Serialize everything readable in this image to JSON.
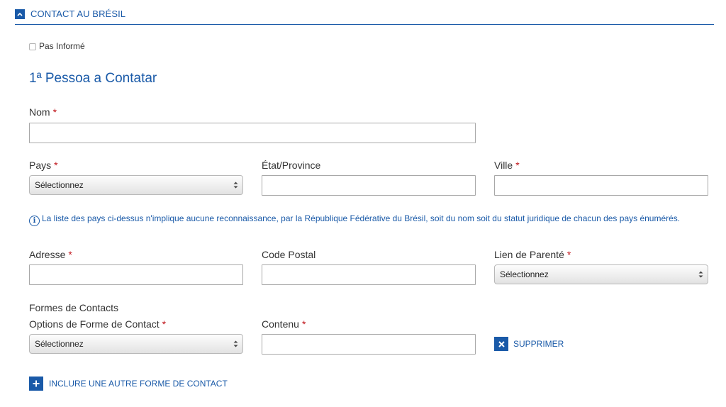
{
  "section": {
    "title": "CONTACT AU BRÉSIL"
  },
  "not_informed": {
    "label": "Pas Informé"
  },
  "person": {
    "title": "1ª Pessoa a Contatar"
  },
  "fields": {
    "name": {
      "label": "Nom",
      "value": ""
    },
    "country": {
      "label": "Pays",
      "selected": "Sélectionnez"
    },
    "state": {
      "label": "État/Province",
      "value": ""
    },
    "city": {
      "label": "Ville",
      "value": ""
    },
    "address": {
      "label": "Adresse",
      "value": ""
    },
    "postal": {
      "label": "Code Postal",
      "value": ""
    },
    "kinship": {
      "label": "Lien de Parenté",
      "selected": "Sélectionnez"
    }
  },
  "required_marker": "*",
  "info": {
    "text": "La liste des pays ci-dessus n'implique aucune reconnaissance, par la République Fédérative du Brésil, soit du nom soit du statut juridique de chacun des pays énumérés."
  },
  "contact_forms": {
    "heading": "Formes de Contacts",
    "option_label": "Options de Forme de Contact",
    "option_selected": "Sélectionnez",
    "content_label": "Contenu",
    "content_value": "",
    "remove_label": "SUPPRIMER",
    "add_label": "INCLURE UNE AUTRE FORME DE CONTACT"
  },
  "colors": {
    "accent": "#1a5aa8",
    "required": "#c0161c"
  }
}
